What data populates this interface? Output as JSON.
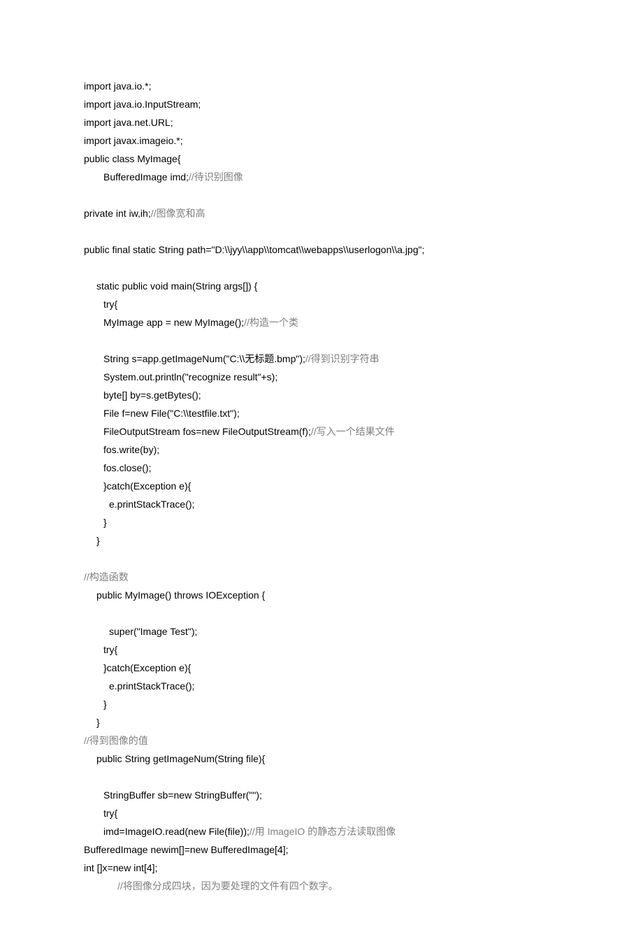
{
  "lines": [
    {
      "indent": 0,
      "segments": [
        {
          "t": "import java.io.*;",
          "c": false
        }
      ]
    },
    {
      "indent": 0,
      "segments": [
        {
          "t": "import java.io.InputStream;",
          "c": false
        }
      ]
    },
    {
      "indent": 0,
      "segments": [
        {
          "t": "import java.net.URL;",
          "c": false
        }
      ]
    },
    {
      "indent": 0,
      "segments": [
        {
          "t": "import javax.imageio.*;",
          "c": false
        }
      ]
    },
    {
      "indent": 0,
      "segments": [
        {
          "t": "public class MyImage{",
          "c": false
        }
      ]
    },
    {
      "indent": 2,
      "segments": [
        {
          "t": "BufferedImage imd;",
          "c": false
        },
        {
          "t": "//待识别图像",
          "c": true
        }
      ]
    },
    {
      "blank": true
    },
    {
      "indent": 0,
      "segments": [
        {
          "t": "private int iw,ih;",
          "c": false
        },
        {
          "t": "//图像宽和高",
          "c": true
        }
      ]
    },
    {
      "blank": true
    },
    {
      "indent": 0,
      "segments": [
        {
          "t": "public final static String path=\"D:\\\\jyy\\\\app\\\\tomcat\\\\webapps\\\\userlogon\\\\a.jpg\";",
          "c": false
        }
      ]
    },
    {
      "blank": true
    },
    {
      "indent": 1,
      "segments": [
        {
          "t": "static public void main(String args[]) {",
          "c": false
        }
      ]
    },
    {
      "indent": 2,
      "segments": [
        {
          "t": "try{",
          "c": false
        }
      ]
    },
    {
      "indent": 2,
      "segments": [
        {
          "t": "MyImage app = new MyImage();",
          "c": false
        },
        {
          "t": "//构造一个类",
          "c": true
        }
      ]
    },
    {
      "blank": true
    },
    {
      "indent": 2,
      "segments": [
        {
          "t": "String s=app.getImageNum(\"C:\\\\无标题.bmp\");",
          "c": false
        },
        {
          "t": "//得到识别字符串",
          "c": true
        }
      ]
    },
    {
      "indent": 2,
      "segments": [
        {
          "t": "System.out.println(\"recognize result\"+s);",
          "c": false
        }
      ]
    },
    {
      "indent": 2,
      "segments": [
        {
          "t": "byte[] by=s.getBytes();",
          "c": false
        }
      ]
    },
    {
      "indent": 2,
      "segments": [
        {
          "t": "File f=new File(\"C:\\\\testfile.txt\");",
          "c": false
        }
      ]
    },
    {
      "indent": 2,
      "segments": [
        {
          "t": "FileOutputStream fos=new FileOutputStream(f);",
          "c": false
        },
        {
          "t": "//写入一个结果文件",
          "c": true
        }
      ]
    },
    {
      "indent": 2,
      "segments": [
        {
          "t": "fos.write(by);",
          "c": false
        }
      ]
    },
    {
      "indent": 2,
      "segments": [
        {
          "t": "fos.close();",
          "c": false
        }
      ]
    },
    {
      "indent": 2,
      "segments": [
        {
          "t": "}catch(Exception e){",
          "c": false
        }
      ]
    },
    {
      "indent": 3,
      "segments": [
        {
          "t": "e.printStackTrace();",
          "c": false
        }
      ]
    },
    {
      "indent": 2,
      "segments": [
        {
          "t": "}",
          "c": false
        }
      ]
    },
    {
      "indent": 1,
      "segments": [
        {
          "t": "}",
          "c": false
        }
      ]
    },
    {
      "blank": true
    },
    {
      "indent": 0,
      "segments": [
        {
          "t": "//构造函数",
          "c": true
        }
      ]
    },
    {
      "indent": 1,
      "segments": [
        {
          "t": "public MyImage() throws IOException {",
          "c": false
        }
      ]
    },
    {
      "blank": true
    },
    {
      "indent": 3,
      "segments": [
        {
          "t": "super(\"Image Test\");",
          "c": false
        }
      ]
    },
    {
      "indent": 2,
      "segments": [
        {
          "t": "try{",
          "c": false
        }
      ]
    },
    {
      "indent": 2,
      "segments": [
        {
          "t": "}catch(Exception e){",
          "c": false
        }
      ]
    },
    {
      "indent": 3,
      "segments": [
        {
          "t": "e.printStackTrace();",
          "c": false
        }
      ]
    },
    {
      "indent": 2,
      "segments": [
        {
          "t": "}",
          "c": false
        }
      ]
    },
    {
      "indent": 1,
      "segments": [
        {
          "t": "}",
          "c": false
        }
      ]
    },
    {
      "indent": 0,
      "segments": [
        {
          "t": "//得到图像的值",
          "c": true
        }
      ]
    },
    {
      "indent": 1,
      "segments": [
        {
          "t": "public String getImageNum(String file){",
          "c": false
        }
      ]
    },
    {
      "blank": true
    },
    {
      "indent": 2,
      "segments": [
        {
          "t": "StringBuffer sb=new StringBuffer(\"\");",
          "c": false
        }
      ]
    },
    {
      "indent": 2,
      "segments": [
        {
          "t": "try{",
          "c": false
        }
      ]
    },
    {
      "indent": 2,
      "segments": [
        {
          "t": "imd=ImageIO.read(new File(file));",
          "c": false
        },
        {
          "t": "//用 ImageIO 的静态方法读取图像",
          "c": true
        }
      ]
    },
    {
      "indent": 0,
      "segments": [
        {
          "t": "BufferedImage newim[]=new BufferedImage[4];",
          "c": false
        }
      ]
    },
    {
      "indent": 0,
      "segments": [
        {
          "t": "int []x=new int[4];",
          "c": false
        }
      ]
    },
    {
      "indent": 4,
      "segments": [
        {
          "t": "//将图像分成四块，因为要处理的文件有四个数字。",
          "c": true
        }
      ]
    }
  ]
}
